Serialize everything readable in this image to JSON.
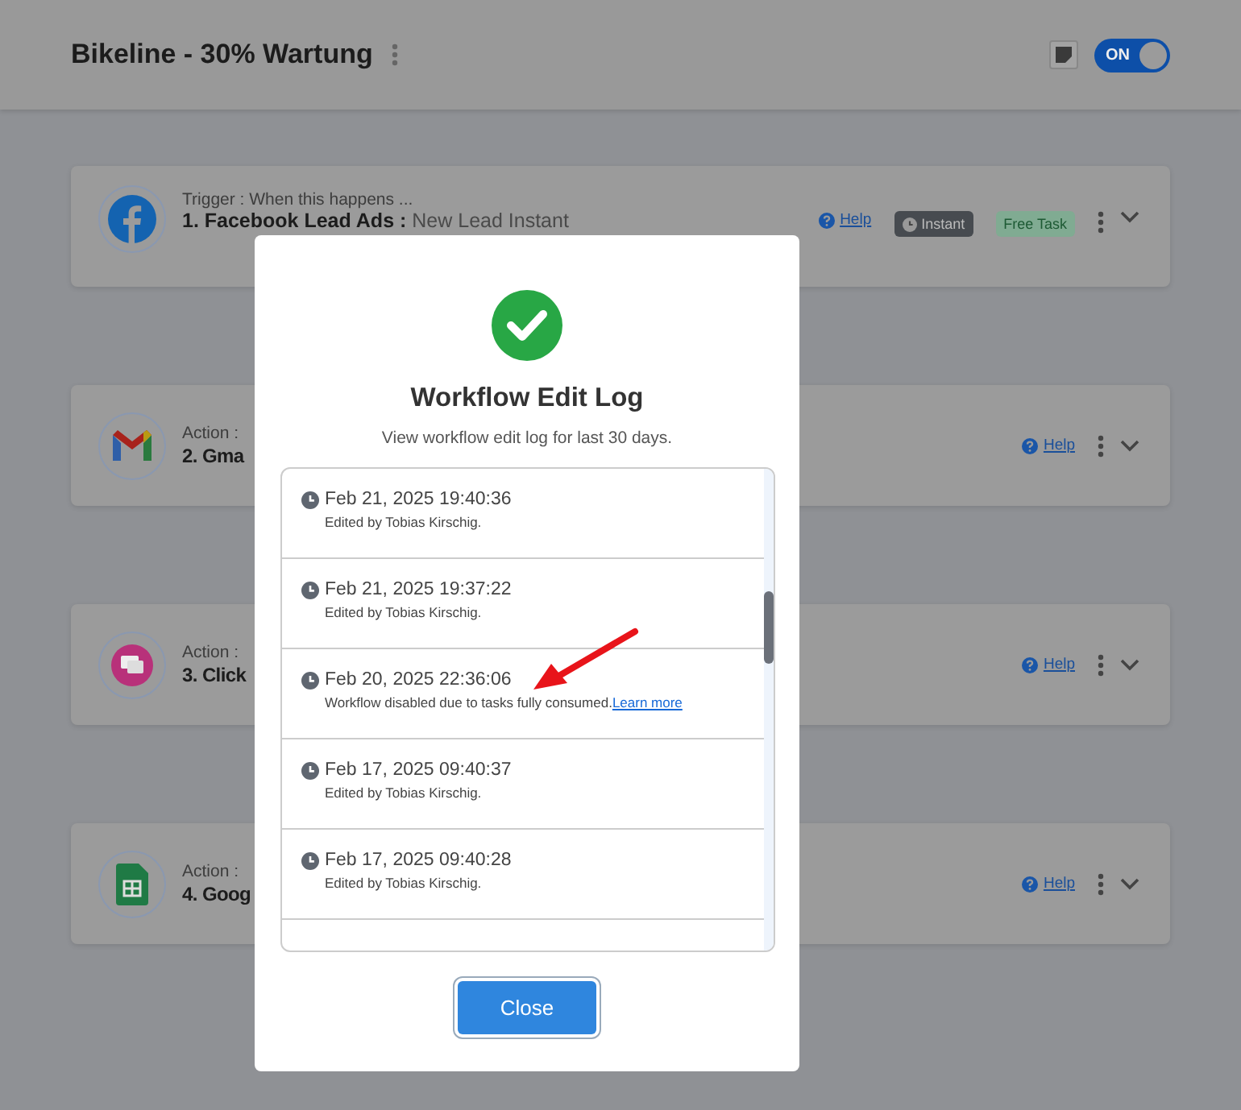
{
  "header": {
    "title": "Bikeline - 30% Wartung",
    "toggle": {
      "label": "ON",
      "on": true
    }
  },
  "steps": [
    {
      "kind": "facebook",
      "label": "Trigger : When this happens ...",
      "title": "1. Facebook Lead Ads : ",
      "subtitle": "New Lead Instant",
      "help": "Help",
      "badges": [
        {
          "kind": "instant",
          "text": "Instant"
        },
        {
          "kind": "free",
          "text": "Free Task"
        }
      ]
    },
    {
      "kind": "gmail",
      "label": "Action :",
      "title": "2. Gma",
      "help": "Help"
    },
    {
      "kind": "chat",
      "label": "Action :",
      "title": "3. Click",
      "help": "Help"
    },
    {
      "kind": "sheets",
      "label": "Action :",
      "title": "4. Goog",
      "help": "Help"
    }
  ],
  "modal": {
    "title": "Workflow Edit Log",
    "subtitle": "View workflow edit log for last 30 days.",
    "entries": [
      {
        "time": "Feb 21, 2025 19:40:36",
        "text": "Edited by Tobias Kirschig."
      },
      {
        "time": "Feb 21, 2025 19:37:22",
        "text": "Edited by Tobias Kirschig."
      },
      {
        "time": "Feb 20, 2025 22:36:06",
        "text": "Workflow disabled due to tasks fully consumed.",
        "link": "Learn more"
      },
      {
        "time": "Feb 17, 2025 09:40:37",
        "text": "Edited by Tobias Kirschig."
      },
      {
        "time": "Feb 17, 2025 09:40:28",
        "text": "Edited by Tobias Kirschig."
      }
    ],
    "close": "Close"
  }
}
